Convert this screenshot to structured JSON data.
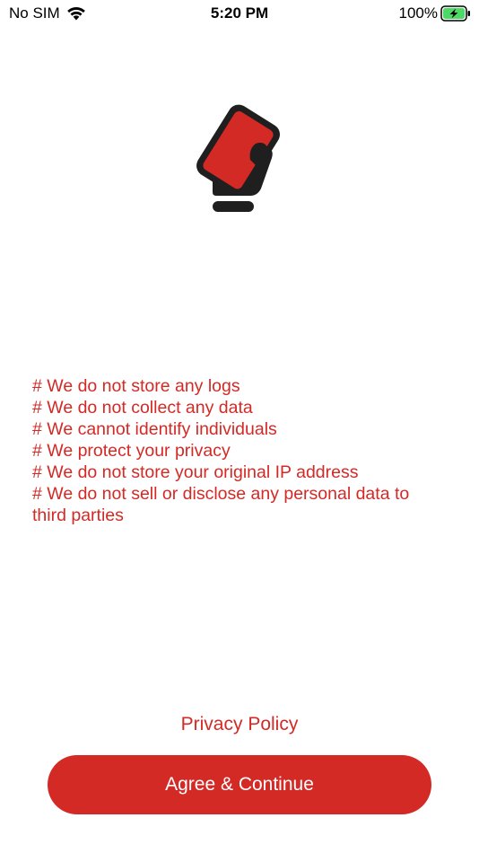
{
  "status_bar": {
    "carrier": "No SIM",
    "time": "5:20 PM",
    "battery_percent": "100%",
    "wifi_icon": "wifi-icon",
    "battery_icon": "battery-charging-icon"
  },
  "logo": {
    "icon": "hand-holding-card-icon"
  },
  "privacy": {
    "items": [
      "# We do not store any logs",
      "# We do not collect any data",
      "# We cannot identify individuals",
      "# We protect your privacy",
      "# We do not store your original IP address",
      "# We do not sell or disclose any personal data to third parties"
    ]
  },
  "footer": {
    "privacy_policy_label": "Privacy Policy",
    "agree_label": "Agree & Continue"
  },
  "colors": {
    "accent": "#d32a26",
    "logo_dark": "#1f1f1f",
    "battery_green": "#4cd964"
  }
}
